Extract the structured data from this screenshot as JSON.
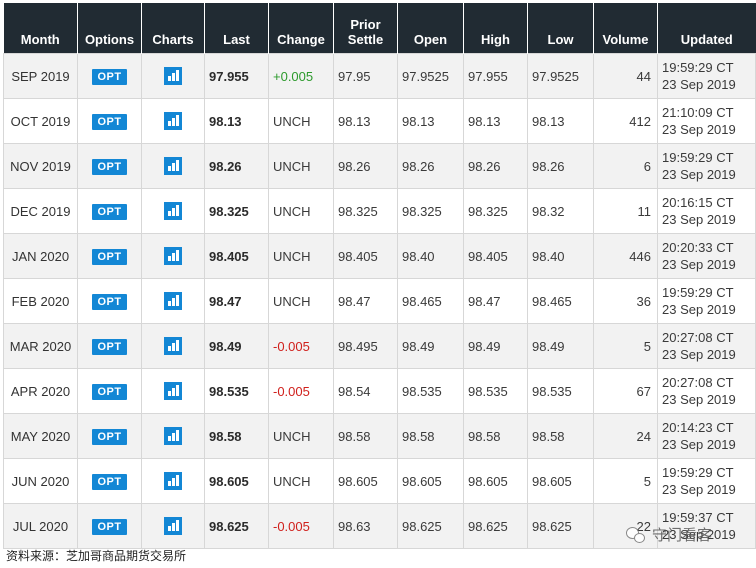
{
  "headers": [
    "Month",
    "Options",
    "Charts",
    "Last",
    "Change",
    "Prior Settle",
    "Open",
    "High",
    "Low",
    "Volume",
    "Updated"
  ],
  "option_label": "OPT",
  "chart_icon": "bar-chart-icon",
  "rows": [
    {
      "month": "SEP 2019",
      "last": "97.955",
      "change": "+0.005",
      "change_dir": "up",
      "prior": "97.95",
      "open": "97.9525",
      "high": "97.955",
      "low": "97.9525",
      "volume": "44",
      "time": "19:59:29 CT",
      "date": "23 Sep 2019"
    },
    {
      "month": "OCT 2019",
      "last": "98.13",
      "change": "UNCH",
      "change_dir": "flat",
      "prior": "98.13",
      "open": "98.13",
      "high": "98.13",
      "low": "98.13",
      "volume": "412",
      "time": "21:10:09 CT",
      "date": "23 Sep 2019"
    },
    {
      "month": "NOV 2019",
      "last": "98.26",
      "change": "UNCH",
      "change_dir": "flat",
      "prior": "98.26",
      "open": "98.26",
      "high": "98.26",
      "low": "98.26",
      "volume": "6",
      "time": "19:59:29 CT",
      "date": "23 Sep 2019"
    },
    {
      "month": "DEC 2019",
      "last": "98.325",
      "change": "UNCH",
      "change_dir": "flat",
      "prior": "98.325",
      "open": "98.325",
      "high": "98.325",
      "low": "98.32",
      "volume": "11",
      "time": "20:16:15 CT",
      "date": "23 Sep 2019"
    },
    {
      "month": "JAN 2020",
      "last": "98.405",
      "change": "UNCH",
      "change_dir": "flat",
      "prior": "98.405",
      "open": "98.40",
      "high": "98.405",
      "low": "98.40",
      "volume": "446",
      "time": "20:20:33 CT",
      "date": "23 Sep 2019"
    },
    {
      "month": "FEB 2020",
      "last": "98.47",
      "change": "UNCH",
      "change_dir": "flat",
      "prior": "98.47",
      "open": "98.465",
      "high": "98.47",
      "low": "98.465",
      "volume": "36",
      "time": "19:59:29 CT",
      "date": "23 Sep 2019"
    },
    {
      "month": "MAR 2020",
      "last": "98.49",
      "change": "-0.005",
      "change_dir": "down",
      "prior": "98.495",
      "open": "98.49",
      "high": "98.49",
      "low": "98.49",
      "volume": "5",
      "time": "20:27:08 CT",
      "date": "23 Sep 2019"
    },
    {
      "month": "APR 2020",
      "last": "98.535",
      "change": "-0.005",
      "change_dir": "down",
      "prior": "98.54",
      "open": "98.535",
      "high": "98.535",
      "low": "98.535",
      "volume": "67",
      "time": "20:27:08 CT",
      "date": "23 Sep 2019"
    },
    {
      "month": "MAY 2020",
      "last": "98.58",
      "change": "UNCH",
      "change_dir": "flat",
      "prior": "98.58",
      "open": "98.58",
      "high": "98.58",
      "low": "98.58",
      "volume": "24",
      "time": "20:14:23 CT",
      "date": "23 Sep 2019"
    },
    {
      "month": "JUN 2020",
      "last": "98.605",
      "change": "UNCH",
      "change_dir": "flat",
      "prior": "98.605",
      "open": "98.605",
      "high": "98.605",
      "low": "98.605",
      "volume": "5",
      "time": "19:59:29 CT",
      "date": "23 Sep 2019"
    },
    {
      "month": "JUL 2020",
      "last": "98.625",
      "change": "-0.005",
      "change_dir": "down",
      "prior": "98.63",
      "open": "98.625",
      "high": "98.625",
      "low": "98.625",
      "volume": "22",
      "time": "19:59:37 CT",
      "date": "23 Sep 2019"
    }
  ],
  "caption": "资料来源：芝加哥商品期货交易所",
  "watermark": "守门看客",
  "colors": {
    "header_bg": "#212b33",
    "accent": "#1387d5",
    "positive": "#2c9a2c",
    "negative": "#d0201c",
    "row_alt": "#f2f2f2"
  }
}
